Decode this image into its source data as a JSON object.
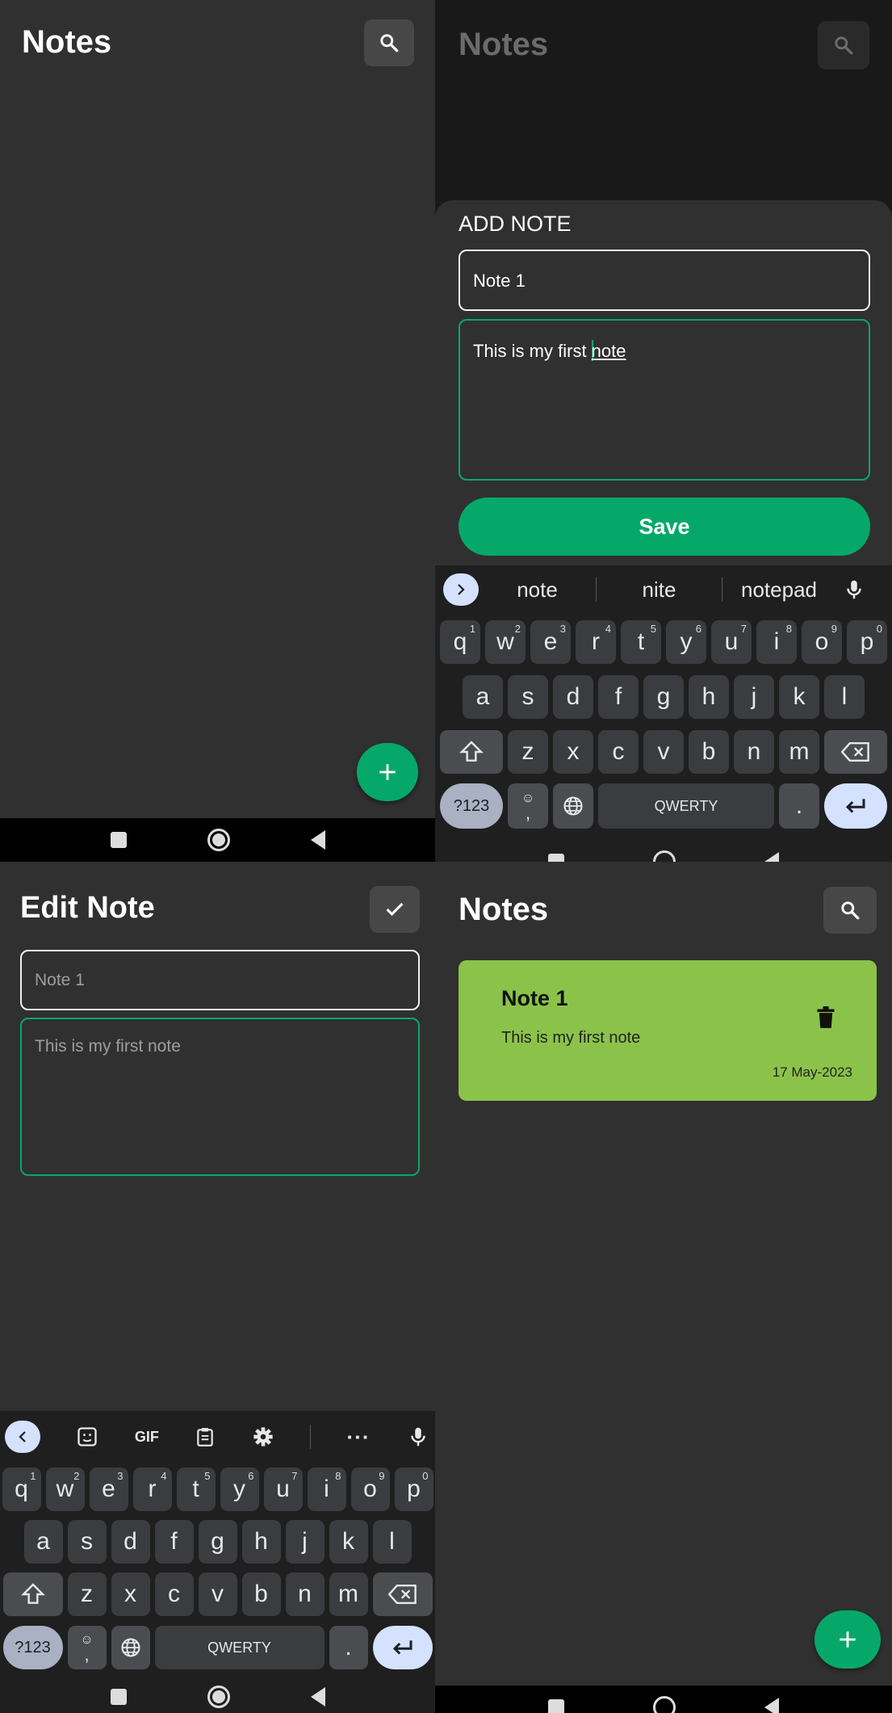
{
  "home_empty": {
    "title": "Notes",
    "search_icon": "search-icon",
    "fab_icon": "plus-icon"
  },
  "add_note": {
    "title": "Notes",
    "sheet_title": "ADD NOTE",
    "title_value": "Note 1",
    "body_before_cursor": "This is my first ",
    "body_composing": "note",
    "save_label": "Save",
    "suggestions": [
      "note",
      "nite",
      "notepad"
    ]
  },
  "edit_note": {
    "title": "Edit Note",
    "title_value": "Note 1",
    "body_value": "This is my first note",
    "check_icon": "check-icon",
    "toolbar_icons": [
      "chevron-left-icon",
      "sticker-icon",
      "gif-icon",
      "clipboard-icon",
      "gear-icon",
      "more-icon",
      "mic-icon"
    ],
    "gif_label": "GIF"
  },
  "home_list": {
    "title": "Notes",
    "note": {
      "title": "Note 1",
      "body": "This is my first note",
      "date": "17 May-2023",
      "card_color": "#8bc34a"
    }
  },
  "keyboard": {
    "row1": [
      [
        "q",
        "1"
      ],
      [
        "w",
        "2"
      ],
      [
        "e",
        "3"
      ],
      [
        "r",
        "4"
      ],
      [
        "t",
        "5"
      ],
      [
        "y",
        "6"
      ],
      [
        "u",
        "7"
      ],
      [
        "i",
        "8"
      ],
      [
        "o",
        "9"
      ],
      [
        "p",
        "0"
      ]
    ],
    "row2": [
      "a",
      "s",
      "d",
      "f",
      "g",
      "h",
      "j",
      "k",
      "l"
    ],
    "row3": [
      "z",
      "x",
      "c",
      "v",
      "b",
      "n",
      "m"
    ],
    "sym_label": "?123",
    "comma_label": ",",
    "space_label": "QWERTY",
    "period_label": "."
  },
  "colors": {
    "accent": "#06a86a",
    "background": "#303030",
    "dim_background": "#191919",
    "card": "#8bc34a"
  }
}
